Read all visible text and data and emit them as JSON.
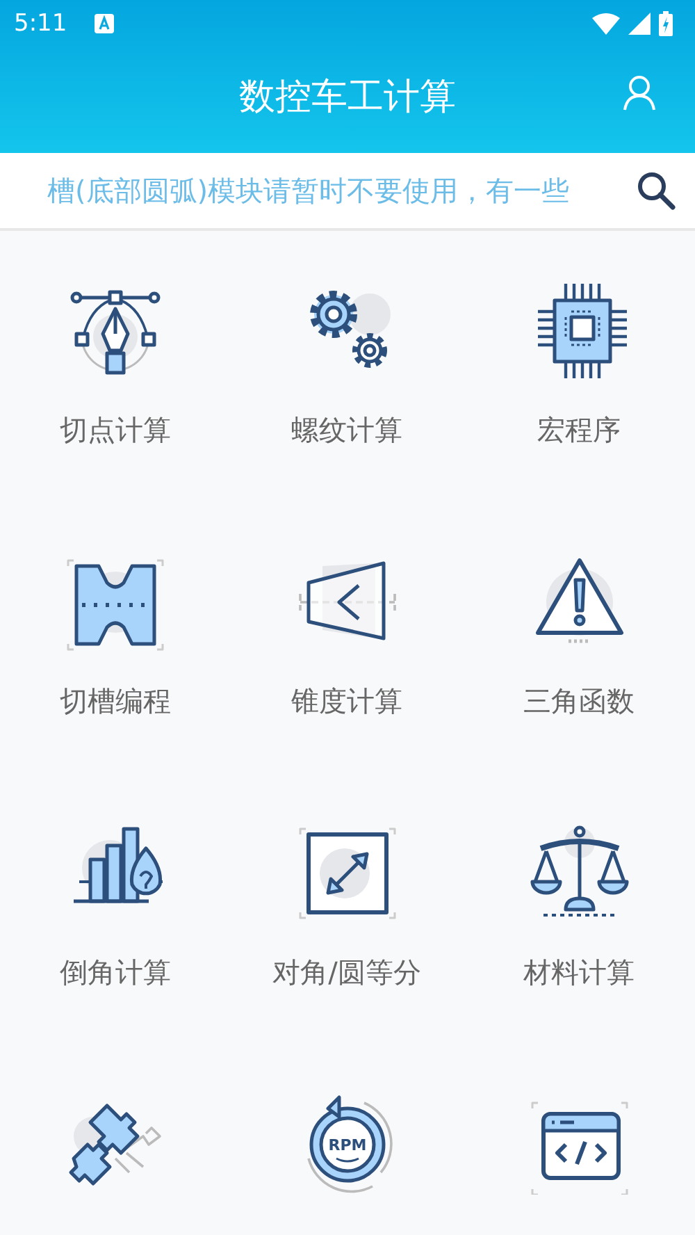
{
  "status_bar": {
    "time": "5:11"
  },
  "app_bar": {
    "title": "数控车工计算"
  },
  "notice_bar": {
    "text": "槽(底部圆弧)模块请暂时不要使用，有一些"
  },
  "tools": [
    {
      "kind": "tool",
      "label": "切点计算"
    },
    {
      "kind": "tool",
      "label": "螺纹计算"
    },
    {
      "kind": "tool",
      "label": "宏程序"
    },
    {
      "kind": "tool",
      "label": "切槽编程"
    },
    {
      "kind": "tool",
      "label": "锥度计算"
    },
    {
      "kind": "tool",
      "label": "三角函数"
    },
    {
      "kind": "tool",
      "label": "倒角计算"
    },
    {
      "kind": "tool",
      "label": "对角/圆等分"
    },
    {
      "kind": "tool",
      "label": "材料计算"
    },
    {
      "kind": "tool"
    },
    {
      "kind": "tool",
      "icon_text": "RPM"
    },
    {
      "kind": "tool"
    }
  ]
}
